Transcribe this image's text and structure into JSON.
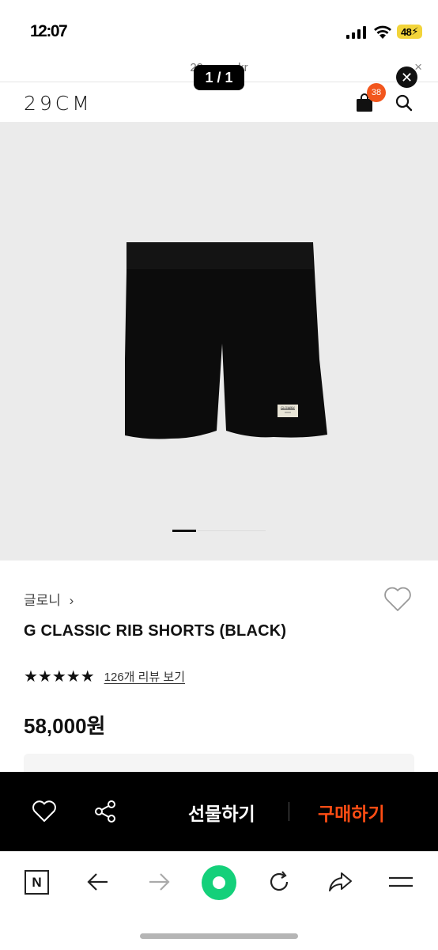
{
  "status_bar": {
    "time": "12:07",
    "battery": "48"
  },
  "url_bar": {
    "url": "29cm.co.kr",
    "close": "×"
  },
  "overlay": {
    "counter": "1 / 1"
  },
  "header": {
    "logo": "29CM",
    "cart_count": "38",
    "cart_icon": "shopping-bag-icon",
    "search_icon": "search-icon"
  },
  "gallery": {
    "image": "black-shorts-product-photo",
    "label_text": "GLOWNY",
    "current_slide": 1,
    "total_slides": 4
  },
  "product": {
    "brand": "글로니",
    "brand_chevron": "›",
    "name": "G CLASSIC RIB SHORTS (BLACK)",
    "stars": "★★★★★",
    "rating": 5,
    "review_link": "126개 리뷰 보기",
    "price": "58,000원"
  },
  "action_bar": {
    "gift_label": "선물하기",
    "buy_label": "구매하기",
    "buy_color": "#ff4d14"
  },
  "browser_bar": {
    "n_label": "N",
    "home_color": "#14d07a"
  },
  "colors": {
    "badge": "#f2561d",
    "battery": "#f2d43a"
  }
}
